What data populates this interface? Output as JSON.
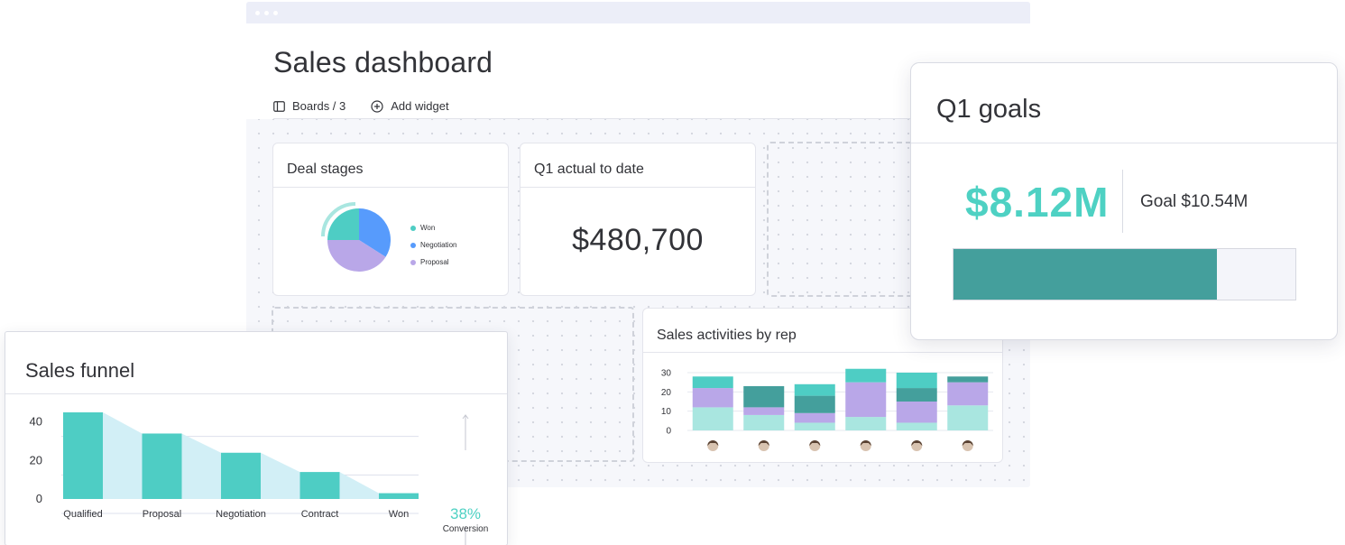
{
  "page": {
    "title": "Sales dashboard",
    "toolbar": {
      "boards_label": "Boards / 3",
      "add_widget_label": "Add widget"
    }
  },
  "deal_stages": {
    "title": "Deal stages",
    "legend": [
      {
        "label": "Won",
        "color": "#4ecdc4"
      },
      {
        "label": "Negotiation",
        "color": "#579bfc"
      },
      {
        "label": "Proposal",
        "color": "#b9a7e8"
      }
    ]
  },
  "q1_actual": {
    "title": "Q1 actual to date",
    "value": "$480,700"
  },
  "sales_activities": {
    "title": "Sales activities by rep"
  },
  "q1_goals": {
    "title": "Q1 goals",
    "amount": "$8.12M",
    "goal_label": "Goal $10.54M",
    "progress_fraction": 0.77
  },
  "sales_funnel": {
    "title": "Sales funnel",
    "conversion_value": "38%",
    "conversion_label": "Conversion"
  },
  "colors": {
    "teal": "#4ecdc4",
    "dark_teal": "#449f9c",
    "light_teal": "#a9e6e0",
    "purple": "#b9a7e8",
    "blue": "#579bfc",
    "funnel_fill": "#d2eff6"
  },
  "chart_data": [
    {
      "type": "pie",
      "title": "Deal stages",
      "categories": [
        "Won",
        "Negotiation",
        "Proposal"
      ],
      "values": [
        25,
        34,
        41
      ],
      "colors": [
        "#4ecdc4",
        "#579bfc",
        "#b9a7e8"
      ]
    },
    {
      "type": "bar",
      "stacked": true,
      "title": "Sales activities by rep",
      "categories": [
        "rep1",
        "rep2",
        "rep3",
        "rep4",
        "rep5",
        "rep6"
      ],
      "ylim": [
        0,
        30
      ],
      "yticks": [
        0,
        10,
        20,
        30
      ],
      "grid": true,
      "series": [
        {
          "values": [
            12,
            8,
            4,
            7,
            4,
            13
          ],
          "color": "#a9e6e0"
        },
        {
          "values": [
            0,
            0,
            5,
            0,
            11,
            0
          ],
          "color": "#b9a7e8"
        },
        {
          "values": [
            0,
            4,
            0,
            0,
            0,
            0
          ],
          "color": "#b9a7e8"
        },
        {
          "values": [
            0,
            0,
            0,
            18,
            0,
            12
          ],
          "color": "#b9a7e8"
        },
        {
          "values": [
            10,
            0,
            0,
            0,
            0,
            0
          ],
          "color": "#b9a7e8"
        },
        {
          "values": [
            0,
            11,
            9,
            0,
            7,
            0
          ],
          "color": "#449f9c"
        },
        {
          "values": [
            6,
            0,
            6,
            7,
            8,
            0
          ],
          "color": "#4ecdc4"
        },
        {
          "values": [
            0,
            0,
            0,
            0,
            0,
            3
          ],
          "color": "#449f9c"
        }
      ]
    },
    {
      "type": "bar",
      "title": "Sales funnel",
      "categories": [
        "Qualified",
        "Proposal",
        "Negotiation",
        "Contract",
        "Won"
      ],
      "values": [
        45,
        34,
        24,
        14,
        3
      ],
      "ylim": [
        0,
        45
      ],
      "yticks": [
        0,
        20,
        40
      ],
      "grid": true,
      "color": "#4ecdc4"
    }
  ]
}
